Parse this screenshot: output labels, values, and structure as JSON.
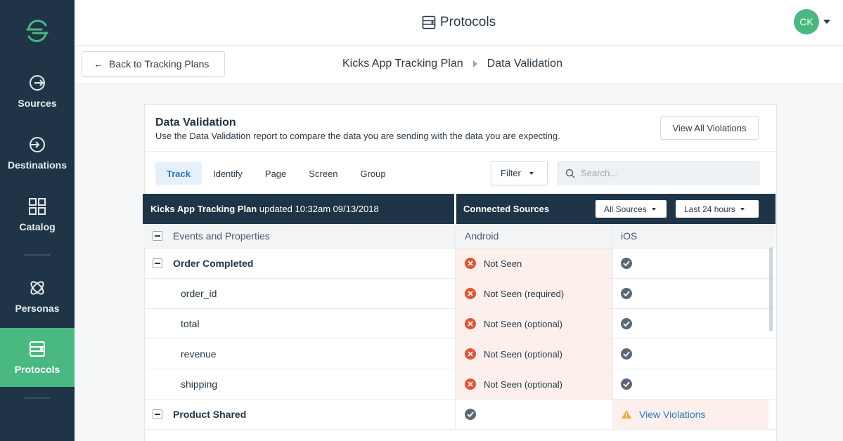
{
  "sidebar": {
    "items": [
      {
        "label": "Sources",
        "icon": "sources-icon"
      },
      {
        "label": "Destinations",
        "icon": "destinations-icon"
      },
      {
        "label": "Catalog",
        "icon": "catalog-icon"
      },
      {
        "label": "Personas",
        "icon": "personas-icon"
      },
      {
        "label": "Protocols",
        "icon": "protocols-icon",
        "active": true
      }
    ]
  },
  "header": {
    "title": "Protocols",
    "avatar_initials": "CK"
  },
  "subheader": {
    "back_label": "Back to Tracking Plans",
    "breadcrumb": [
      "Kicks App Tracking Plan",
      "Data Validation"
    ]
  },
  "card": {
    "title": "Data Validation",
    "description": "Use the Data Validation report to compare the data you are sending with the data you are expecting.",
    "view_all_label": "View All Violations",
    "tabs": [
      "Track",
      "Identify",
      "Page",
      "Screen",
      "Group"
    ],
    "active_tab": "Track",
    "filter_label": "Filter",
    "search_placeholder": "Search..."
  },
  "table": {
    "plan_name": "Kicks App Tracking Plan",
    "updated_text": "updated 10:32am 09/13/2018",
    "connected_label": "Connected Sources",
    "sources_dropdown": "All Sources",
    "time_dropdown": "Last 24 hours",
    "columns": [
      "Events and Properties",
      "Android",
      "iOS"
    ],
    "rows": [
      {
        "type": "event",
        "name": "Order Completed",
        "android": "Not Seen",
        "ios": "ok"
      },
      {
        "type": "property",
        "name": "order_id",
        "android": "Not Seen (required)",
        "ios": "ok"
      },
      {
        "type": "property",
        "name": "total",
        "android": "Not Seen (optional)",
        "ios": "ok"
      },
      {
        "type": "property",
        "name": "revenue",
        "android": "Not Seen (optional)",
        "ios": "ok"
      },
      {
        "type": "property",
        "name": "shipping",
        "android": "Not Seen (optional)",
        "ios": "ok"
      },
      {
        "type": "event",
        "name": "Product Shared",
        "android": "ok",
        "ios": "View Violations"
      }
    ]
  },
  "colors": {
    "sidebar_bg": "#1f3547",
    "accent_green": "#49b881",
    "error_red": "#e5532f",
    "link_blue": "#2a78c8",
    "warning_amber": "#f0a92e"
  }
}
